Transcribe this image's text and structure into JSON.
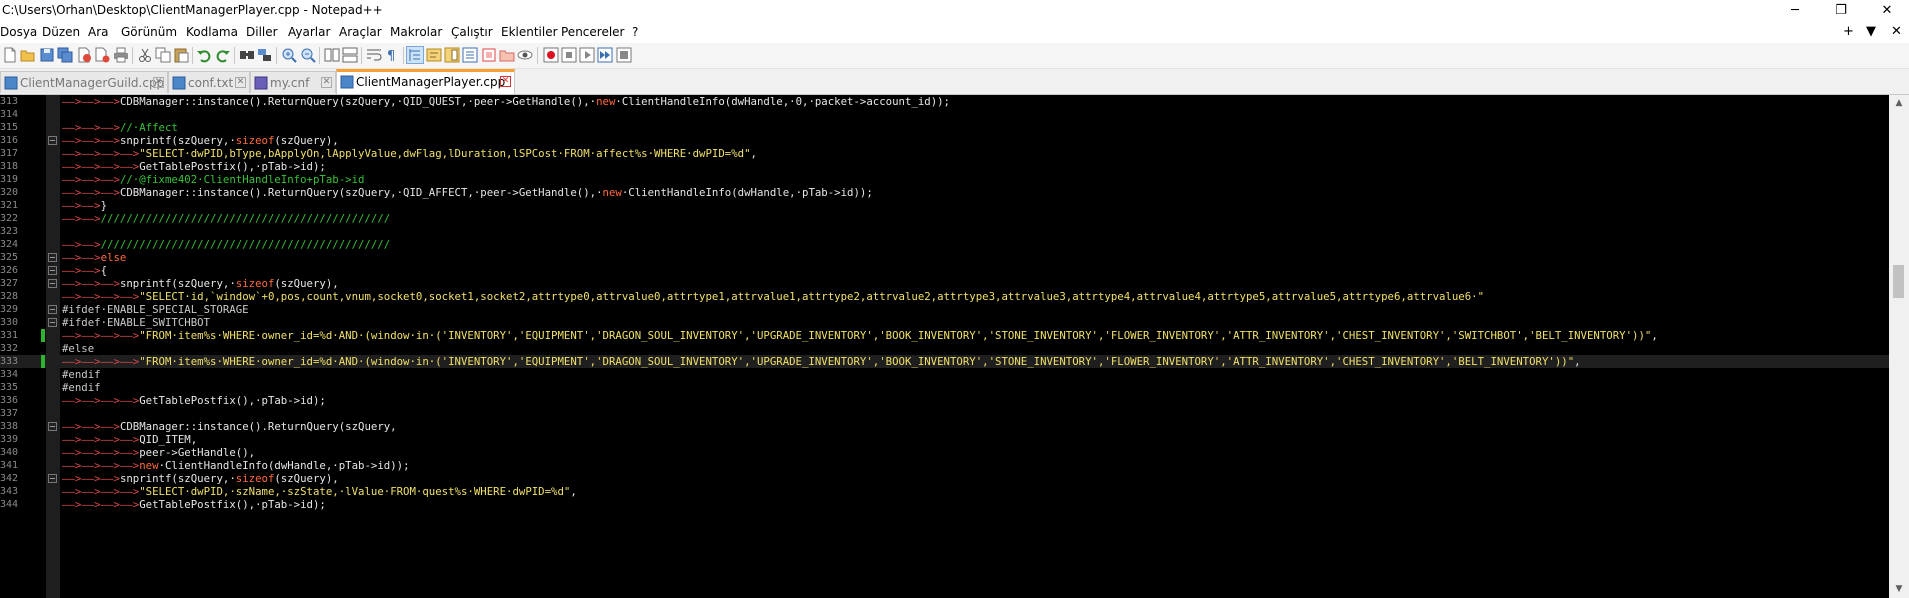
{
  "window": {
    "title": "C:\\Users\\Orhan\\Desktop\\ClientManagerPlayer.cpp - Notepad++",
    "minimize": "─",
    "maximize": "❐",
    "close": "✕"
  },
  "menu": {
    "items": [
      "Dosya",
      "Düzen",
      "Ara",
      "Görünüm",
      "Kodlama",
      "Diller",
      "Ayarlar",
      "Araçlar",
      "Makrolar",
      "Çalıştır",
      "Eklentiler",
      "Pencereler",
      "?"
    ],
    "right_controls": [
      "+",
      "▼",
      "✕"
    ]
  },
  "toolbar": {
    "buttons": [
      "new-file-icon",
      "open-file-icon",
      "save-icon",
      "save-all-icon",
      "close-icon",
      "close-all-icon",
      "print-icon",
      "cut-icon",
      "copy-icon",
      "paste-icon",
      "undo-icon",
      "redo-icon",
      "find-icon",
      "replace-icon",
      "zoom-in-icon",
      "zoom-out-icon",
      "sync-vertical-icon",
      "sync-horizontal-icon",
      "word-wrap-icon",
      "show-all-characters-icon",
      "indent-guide-icon",
      "user-language-icon",
      "document-map-icon",
      "function-list-icon",
      "folder-as-workspace-icon",
      "doc-list-icon",
      "monitoring-icon",
      "record-macro-icon",
      "stop-recording-icon",
      "play-macro-icon",
      "run-macro-multiple-icon",
      "save-macro-icon"
    ]
  },
  "tabs": [
    {
      "label": "ClientManagerGuild.cpp",
      "active": false
    },
    {
      "label": "conf.txt",
      "active": false
    },
    {
      "label": "my.cnf",
      "active": false
    },
    {
      "label": "ClientManagerPlayer.cpp",
      "active": true
    }
  ],
  "editor": {
    "colors": {
      "background": "#000000",
      "keyword": "#ff6a3c",
      "string": "#f0e068",
      "comment": "#36c236",
      "indent_arrow": "#d94a4a"
    },
    "lines": [
      {
        "num": "313",
        "text": "——>——>——>CDBManager::instance().ReturnQuery(szQuery,·QID_QUEST,·peer->GetHandle(),·new·ClientHandleInfo(dwHandle,·0,·packet->account_id));",
        "fold": false,
        "changed": false,
        "current": false
      },
      {
        "num": "314",
        "text": "",
        "fold": false,
        "changed": false,
        "current": false
      },
      {
        "num": "315",
        "text": "——>——>——>//·Affect",
        "fold": false,
        "changed": false,
        "current": false
      },
      {
        "num": "316",
        "text": "——>——>——>snprintf(szQuery,·sizeof(szQuery),",
        "fold": true,
        "changed": false,
        "current": false
      },
      {
        "num": "317",
        "text": "——>——>——>——>\"SELECT·dwPID,bType,bApplyOn,lApplyValue,dwFlag,lDuration,lSPCost·FROM·affect%s·WHERE·dwPID=%d\",",
        "fold": false,
        "changed": false,
        "current": false
      },
      {
        "num": "318",
        "text": "——>——>——>——>GetTablePostfix(),·pTab->id);",
        "fold": false,
        "changed": false,
        "current": false
      },
      {
        "num": "319",
        "text": "——>——>——>//·@fixme402·ClientHandleInfo+pTab->id",
        "fold": false,
        "changed": false,
        "current": false
      },
      {
        "num": "320",
        "text": "——>——>——>CDBManager::instance().ReturnQuery(szQuery,·QID_AFFECT,·peer->GetHandle(),·new·ClientHandleInfo(dwHandle,·pTab->id));",
        "fold": false,
        "changed": false,
        "current": false
      },
      {
        "num": "321",
        "text": "——>——>}",
        "fold": false,
        "changed": false,
        "current": false
      },
      {
        "num": "322",
        "text": "——>——>/////////////////////////////////////////////",
        "fold": false,
        "changed": false,
        "current": false
      },
      {
        "num": "323",
        "text": "",
        "fold": false,
        "changed": false,
        "current": false
      },
      {
        "num": "324",
        "text": "——>——>/////////////////////////////////////////////",
        "fold": false,
        "changed": false,
        "current": false
      },
      {
        "num": "325",
        "text": "——>——>else",
        "fold": true,
        "changed": false,
        "current": false
      },
      {
        "num": "326",
        "text": "——>——>{",
        "fold": true,
        "changed": false,
        "current": false
      },
      {
        "num": "327",
        "text": "——>——>——>snprintf(szQuery,·sizeof(szQuery),",
        "fold": true,
        "changed": false,
        "current": false
      },
      {
        "num": "328",
        "text": "——>——>——>——>\"SELECT·id,`window`+0,pos,count,vnum,socket0,socket1,socket2,attrtype0,attrvalue0,attrtype1,attrvalue1,attrtype2,attrvalue2,attrtype3,attrvalue3,attrtype4,attrvalue4,attrtype5,attrvalue5,attrtype6,attrvalue6·\"",
        "fold": false,
        "changed": false,
        "current": false
      },
      {
        "num": "329",
        "text": "#ifdef·ENABLE_SPECIAL_STORAGE",
        "fold": true,
        "changed": false,
        "current": false
      },
      {
        "num": "330",
        "text": "#ifdef·ENABLE_SWITCHBOT",
        "fold": true,
        "changed": false,
        "current": false
      },
      {
        "num": "331",
        "text": "——>——>——>——>\"FROM·item%s·WHERE·owner_id=%d·AND·(window·in·('INVENTORY','EQUIPMENT','DRAGON_SOUL_INVENTORY','UPGRADE_INVENTORY','BOOK_INVENTORY','STONE_INVENTORY','FLOWER_INVENTORY','ATTR_INVENTORY','CHEST_INVENTORY','SWITCHBOT','BELT_INVENTORY'))\",",
        "fold": false,
        "changed": true,
        "current": false
      },
      {
        "num": "332",
        "text": "#else",
        "fold": false,
        "changed": false,
        "current": false
      },
      {
        "num": "333",
        "text": "——>——>——>——>\"FROM·item%s·WHERE·owner_id=%d·AND·(window·in·('INVENTORY','EQUIPMENT','DRAGON_SOUL_INVENTORY','UPGRADE_INVENTORY','BOOK_INVENTORY','STONE_INVENTORY','FLOWER_INVENTORY','ATTR_INVENTORY','CHEST_INVENTORY','BELT_INVENTORY'))\",",
        "fold": false,
        "changed": true,
        "current": true
      },
      {
        "num": "334",
        "text": "#endif",
        "fold": false,
        "changed": false,
        "current": false
      },
      {
        "num": "335",
        "text": "#endif",
        "fold": false,
        "changed": false,
        "current": false
      },
      {
        "num": "336",
        "text": "——>——>——>——>GetTablePostfix(),·pTab->id);",
        "fold": false,
        "changed": false,
        "current": false
      },
      {
        "num": "337",
        "text": "",
        "fold": false,
        "changed": false,
        "current": false
      },
      {
        "num": "338",
        "text": "——>——>——>CDBManager::instance().ReturnQuery(szQuery,",
        "fold": true,
        "changed": false,
        "current": false
      },
      {
        "num": "339",
        "text": "——>——>——>——>QID_ITEM,",
        "fold": false,
        "changed": false,
        "current": false
      },
      {
        "num": "340",
        "text": "——>——>——>——>peer->GetHandle(),",
        "fold": false,
        "changed": false,
        "current": false
      },
      {
        "num": "341",
        "text": "——>——>——>——>new·ClientHandleInfo(dwHandle,·pTab->id));",
        "fold": false,
        "changed": false,
        "current": false
      },
      {
        "num": "342",
        "text": "——>——>——>snprintf(szQuery,·sizeof(szQuery),",
        "fold": true,
        "changed": false,
        "current": false
      },
      {
        "num": "343",
        "text": "——>——>——>——>\"SELECT·dwPID,·szName,·szState,·lValue·FROM·quest%s·WHERE·dwPID=%d\",",
        "fold": false,
        "changed": false,
        "current": false
      },
      {
        "num": "344",
        "text": "——>——>——>——>GetTablePostfix(),·pTab->id);",
        "fold": false,
        "changed": false,
        "current": false
      }
    ]
  },
  "scrollbar": {
    "up": "▲",
    "down": "▼",
    "position": 0.35,
    "visible_fraction": 0.07
  }
}
